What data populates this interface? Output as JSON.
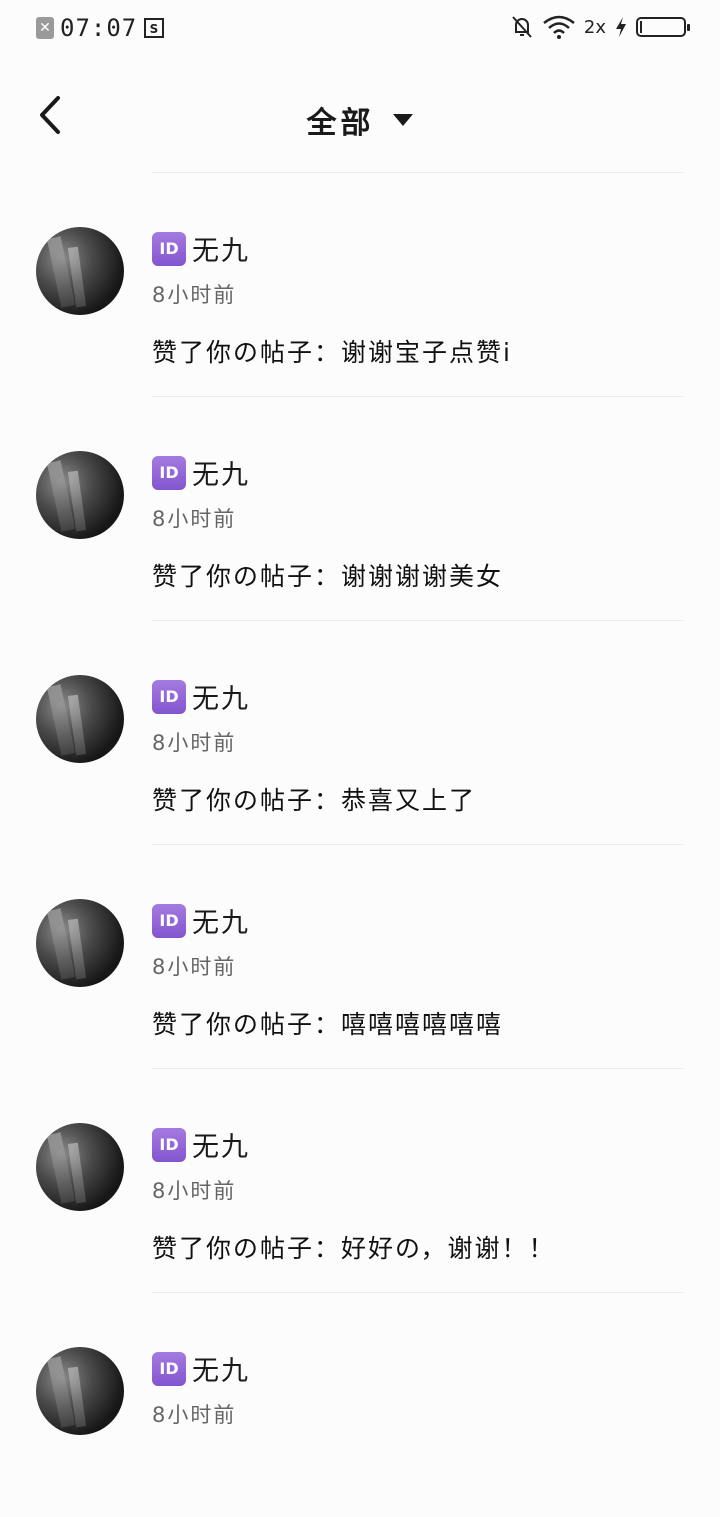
{
  "status_bar": {
    "time": "07:07",
    "network": "2x"
  },
  "header": {
    "title": "全部"
  },
  "notifications": [
    {
      "badge": "ID",
      "name": "无九",
      "time": "8小时前",
      "content": "赞了你の帖子：谢谢宝子点赞i"
    },
    {
      "badge": "ID",
      "name": "无九",
      "time": "8小时前",
      "content": "赞了你の帖子：谢谢谢谢美女"
    },
    {
      "badge": "ID",
      "name": "无九",
      "time": "8小时前",
      "content": "赞了你の帖子：恭喜又上了"
    },
    {
      "badge": "ID",
      "name": "无九",
      "time": "8小时前",
      "content": "赞了你の帖子：嘻嘻嘻嘻嘻嘻"
    },
    {
      "badge": "ID",
      "name": "无九",
      "time": "8小时前",
      "content": "赞了你の帖子：好好の，谢谢！！"
    },
    {
      "badge": "ID",
      "name": "无九",
      "time": "8小时前",
      "content": ""
    }
  ]
}
